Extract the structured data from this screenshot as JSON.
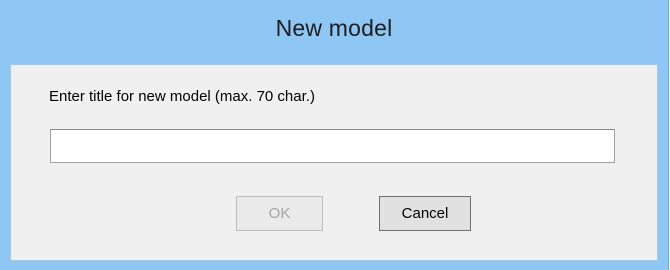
{
  "dialog": {
    "title": "New model",
    "prompt": "Enter title for new model (max. 70 char.)",
    "input_value": "",
    "input_placeholder": "",
    "ok_label": "OK",
    "ok_enabled": false,
    "cancel_label": "Cancel"
  },
  "colors": {
    "title_bar": "#8ec7f3",
    "client_background": "#f0f0f0",
    "disabled_text": "#a3a3a3"
  }
}
